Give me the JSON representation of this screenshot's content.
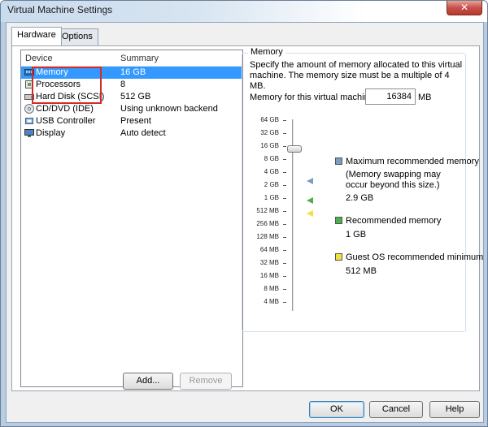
{
  "window": {
    "title": "Virtual Machine Settings",
    "close_glyph": "✕"
  },
  "tabs": [
    {
      "label": "Hardware"
    },
    {
      "label": "Options"
    }
  ],
  "device_list": {
    "headers": {
      "device": "Device",
      "summary": "Summary"
    },
    "rows": [
      {
        "device": "Memory",
        "summary": "16 GB",
        "icon": "memory-icon",
        "selected": true
      },
      {
        "device": "Processors",
        "summary": "8",
        "icon": "processor-icon"
      },
      {
        "device": "Hard Disk (SCSI)",
        "summary": "512 GB",
        "icon": "hard-disk-icon"
      },
      {
        "device": "CD/DVD (IDE)",
        "summary": "Using unknown backend",
        "icon": "cd-dvd-icon"
      },
      {
        "device": "USB Controller",
        "summary": "Present",
        "icon": "usb-icon"
      },
      {
        "device": "Display",
        "summary": "Auto detect",
        "icon": "display-icon"
      }
    ]
  },
  "list_buttons": {
    "add": "Add...",
    "remove": "Remove"
  },
  "memory": {
    "group_title": "Memory",
    "description": "Specify the amount of memory allocated to this virtual machine. The memory size must be a multiple of 4 MB.",
    "field_label": "Memory for this virtual machine:",
    "field_value": "16384",
    "unit": "MB",
    "scale_labels": [
      "64 GB",
      "32 GB",
      "16 GB",
      "8 GB",
      "4 GB",
      "2 GB",
      "1 GB",
      "512 MB",
      "256 MB",
      "128 MB",
      "64 MB",
      "32 MB",
      "16 MB",
      "8 MB",
      "4 MB"
    ],
    "legend": [
      {
        "title": "Maximum recommended memory",
        "note": "(Memory swapping may occur beyond this size.)",
        "value": "2.9 GB",
        "color": "#7d9cc4"
      },
      {
        "title": "Recommended memory",
        "value": "1 GB",
        "color": "#4caf4c"
      },
      {
        "title": "Guest OS recommended minimum",
        "value": "512 MB",
        "color": "#f0e040"
      }
    ]
  },
  "dialog_buttons": {
    "ok": "OK",
    "cancel": "Cancel",
    "help": "Help"
  },
  "colors": {
    "selection": "#3399ff",
    "annotation_box": "#d42a2a"
  }
}
